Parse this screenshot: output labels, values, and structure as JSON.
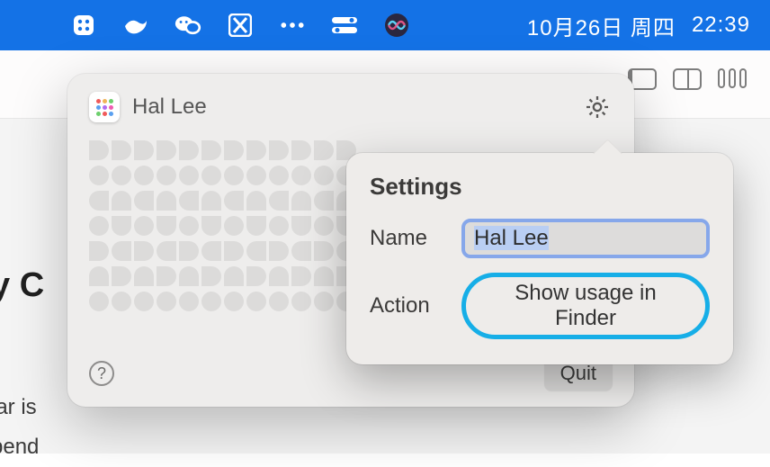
{
  "menubar": {
    "date": "10月26日 周四",
    "time": "22:39"
  },
  "popover": {
    "title": "Hal Lee",
    "quit_label": "Quit"
  },
  "settings": {
    "heading": "Settings",
    "name_label": "Name",
    "name_value": "Hal Lee",
    "action_label": "Action",
    "action_value": "Show usage in Finder"
  },
  "background": {
    "partial_heading": "y C",
    "partial_line1": "lar is",
    "partial_line2": "pend"
  }
}
